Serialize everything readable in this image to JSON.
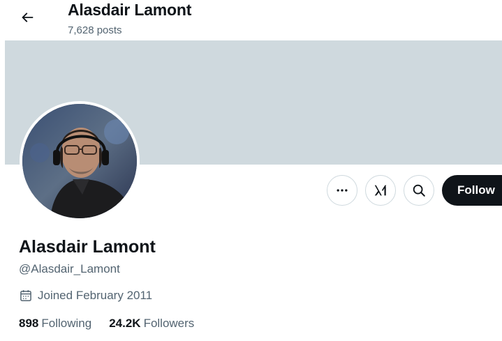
{
  "header": {
    "back_icon": "arrow-left-icon",
    "name": "Alasdair Lamont",
    "posts": "7,628 posts"
  },
  "banner": {
    "color": "#cfd9de"
  },
  "profile": {
    "display_name": "Alasdair Lamont",
    "handle": "@Alasdair_Lamont",
    "joined": "Joined February 2011",
    "joined_icon": "calendar-icon",
    "following_count": "898",
    "following_label": "Following",
    "followers_count": "24.2K",
    "followers_label": "Followers"
  },
  "actions": {
    "more_icon": "more-dots-icon",
    "grok_icon": "grok-icon",
    "search_icon": "search-icon",
    "follow_label": "Follow"
  },
  "colors": {
    "text_primary": "#0f1419",
    "text_secondary": "#536471",
    "border": "#cfd9de",
    "follow_bg": "#0f1419"
  }
}
